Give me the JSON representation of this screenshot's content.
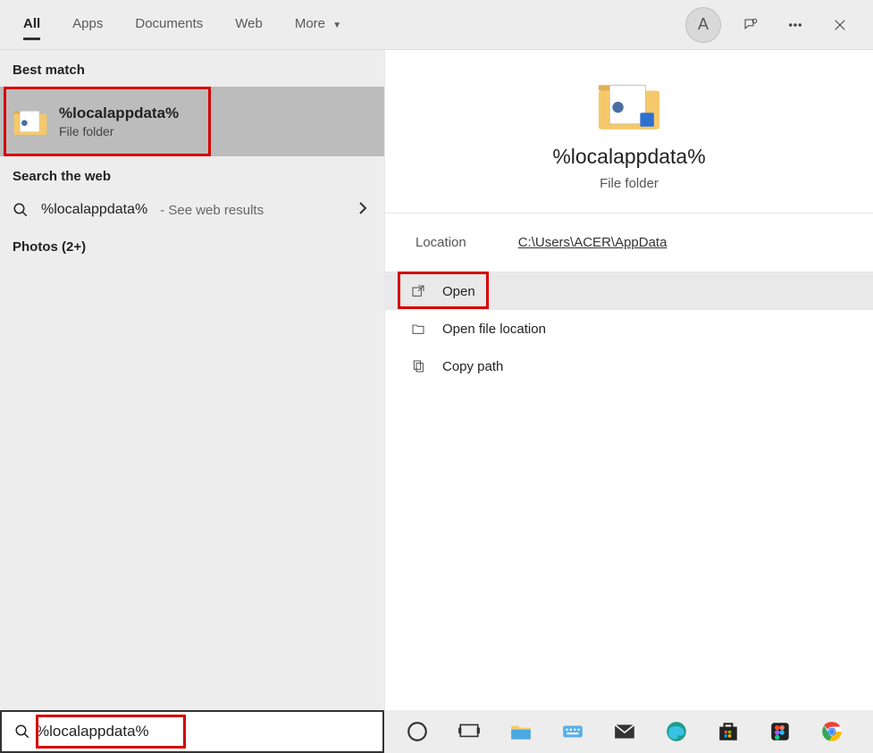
{
  "header": {
    "tabs": {
      "all": "All",
      "apps": "Apps",
      "documents": "Documents",
      "web": "Web",
      "more": "More"
    },
    "avatar_initial": "A"
  },
  "left": {
    "best_match_label": "Best match",
    "best_match": {
      "title": "%localappdata%",
      "subtitle": "File folder"
    },
    "search_web_label": "Search the web",
    "web_result": {
      "query": "%localappdata%",
      "suffix": " - See web results"
    },
    "photos_label": "Photos (2+)"
  },
  "right": {
    "title": "%localappdata%",
    "subtitle": "File folder",
    "location_label": "Location",
    "location_value": "C:\\Users\\ACER\\AppData",
    "actions": {
      "open": "Open",
      "open_loc": "Open file location",
      "copy_path": "Copy path"
    }
  },
  "search": {
    "value": "%localappdata%"
  }
}
